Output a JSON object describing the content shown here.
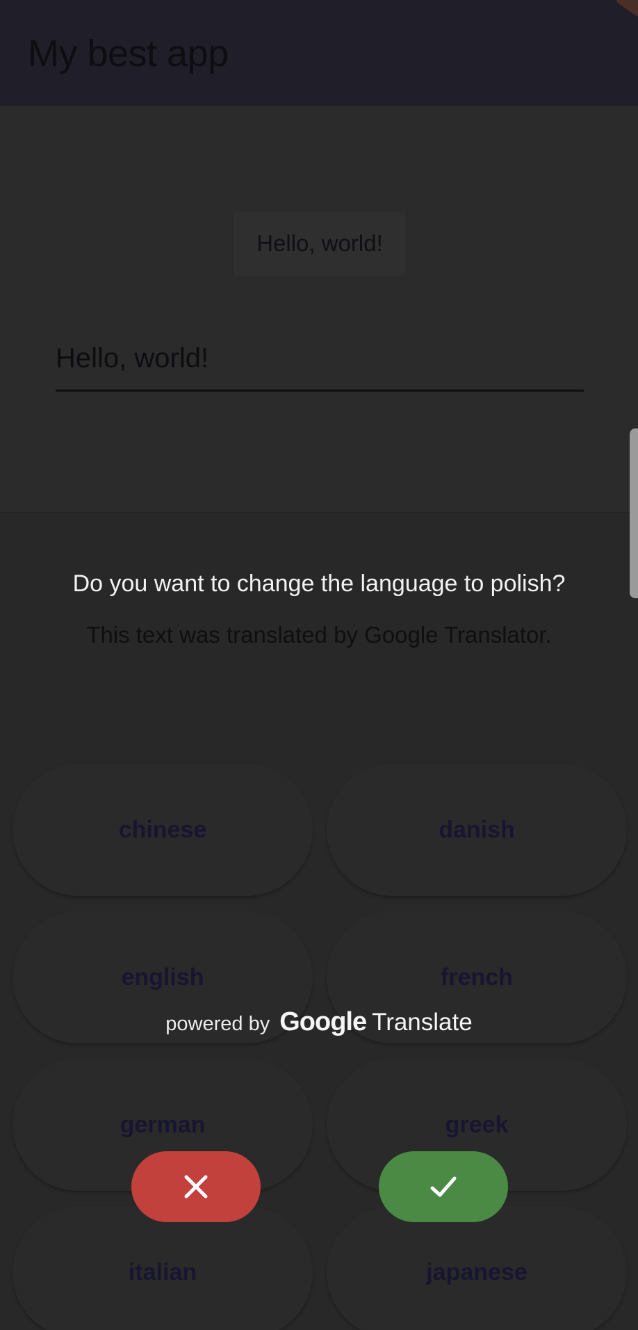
{
  "appbar": {
    "title": "My best app"
  },
  "main": {
    "hello_chip": "Hello, world!",
    "input_value": "Hello, world!"
  },
  "dialog": {
    "question": "Do you want to change the language to polish?",
    "note": "This text was translated by Google Translator.",
    "languages": [
      "chinese",
      "danish",
      "english",
      "french",
      "german",
      "greek",
      "italian",
      "japanese"
    ],
    "powered_by": "powered by",
    "google": "Google",
    "translate": "Translate",
    "cancel_icon": "close-icon",
    "confirm_icon": "check-icon"
  },
  "colors": {
    "cancel": "#c2413d",
    "confirm": "#4a8a44",
    "appbar": "#1f1e29",
    "language_text": "#181530"
  }
}
